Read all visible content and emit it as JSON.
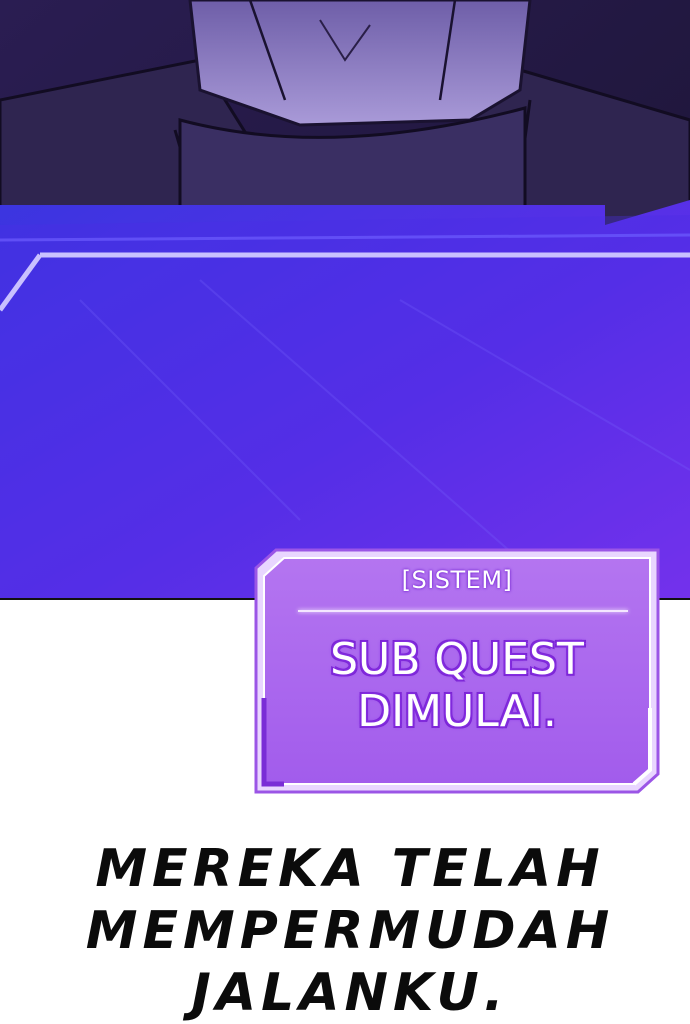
{
  "system_window": {
    "tag": "[SISTEM]",
    "message_line1": "SUB QUEST",
    "message_line2": "DIMULAI."
  },
  "caption": {
    "line1": "MEREKA TELAH",
    "line2": "MEMPERMUDAH",
    "line3": "JALANKU."
  },
  "colors": {
    "accent_purple": "#8a34e8",
    "panel_blue": "#3e2ee0",
    "text_dark": "#0b0b0b"
  }
}
